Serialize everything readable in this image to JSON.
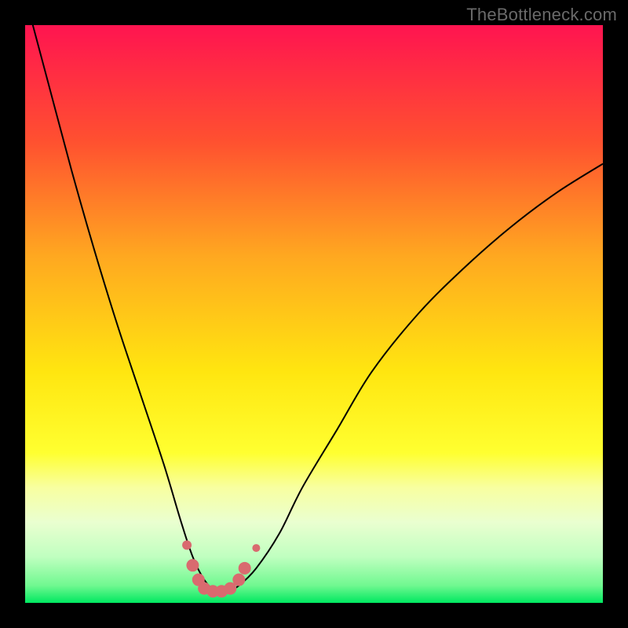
{
  "watermark": "TheBottleneck.com",
  "gradient": {
    "stops": [
      {
        "pct": 0,
        "color": "#ff1450"
      },
      {
        "pct": 20,
        "color": "#ff5030"
      },
      {
        "pct": 40,
        "color": "#ffa820"
      },
      {
        "pct": 60,
        "color": "#ffe610"
      },
      {
        "pct": 74,
        "color": "#ffff30"
      },
      {
        "pct": 80,
        "color": "#f8ffa0"
      },
      {
        "pct": 86,
        "color": "#eaffd0"
      },
      {
        "pct": 92,
        "color": "#c0ffc0"
      },
      {
        "pct": 97,
        "color": "#70f890"
      },
      {
        "pct": 100,
        "color": "#00e860"
      }
    ]
  },
  "chart_data": {
    "type": "line",
    "title": "",
    "xlabel": "",
    "ylabel": "",
    "xlim": [
      0,
      100
    ],
    "ylim": [
      0,
      100
    ],
    "series": [
      {
        "name": "bottleneck-curve",
        "x": [
          0,
          4,
          8,
          12,
          16,
          20,
          24,
          27,
          29,
          31,
          33,
          35,
          37,
          40,
          44,
          48,
          54,
          60,
          68,
          76,
          84,
          92,
          100
        ],
        "y": [
          105,
          90,
          75,
          61,
          48,
          36,
          24,
          14,
          8,
          4,
          2,
          2,
          3,
          6,
          12,
          20,
          30,
          40,
          50,
          58,
          65,
          71,
          76
        ]
      }
    ],
    "markers": {
      "series": "bottleneck-curve",
      "color": "#d96a6f",
      "points": [
        {
          "x": 28.0,
          "y": 10.0,
          "r": 6
        },
        {
          "x": 29.0,
          "y": 6.5,
          "r": 8
        },
        {
          "x": 30.0,
          "y": 4.0,
          "r": 8
        },
        {
          "x": 31.0,
          "y": 2.5,
          "r": 8
        },
        {
          "x": 32.5,
          "y": 2.0,
          "r": 8
        },
        {
          "x": 34.0,
          "y": 2.0,
          "r": 8
        },
        {
          "x": 35.5,
          "y": 2.5,
          "r": 8
        },
        {
          "x": 37.0,
          "y": 4.0,
          "r": 8
        },
        {
          "x": 38.0,
          "y": 6.0,
          "r": 8
        },
        {
          "x": 40.0,
          "y": 9.5,
          "r": 5
        }
      ]
    }
  }
}
